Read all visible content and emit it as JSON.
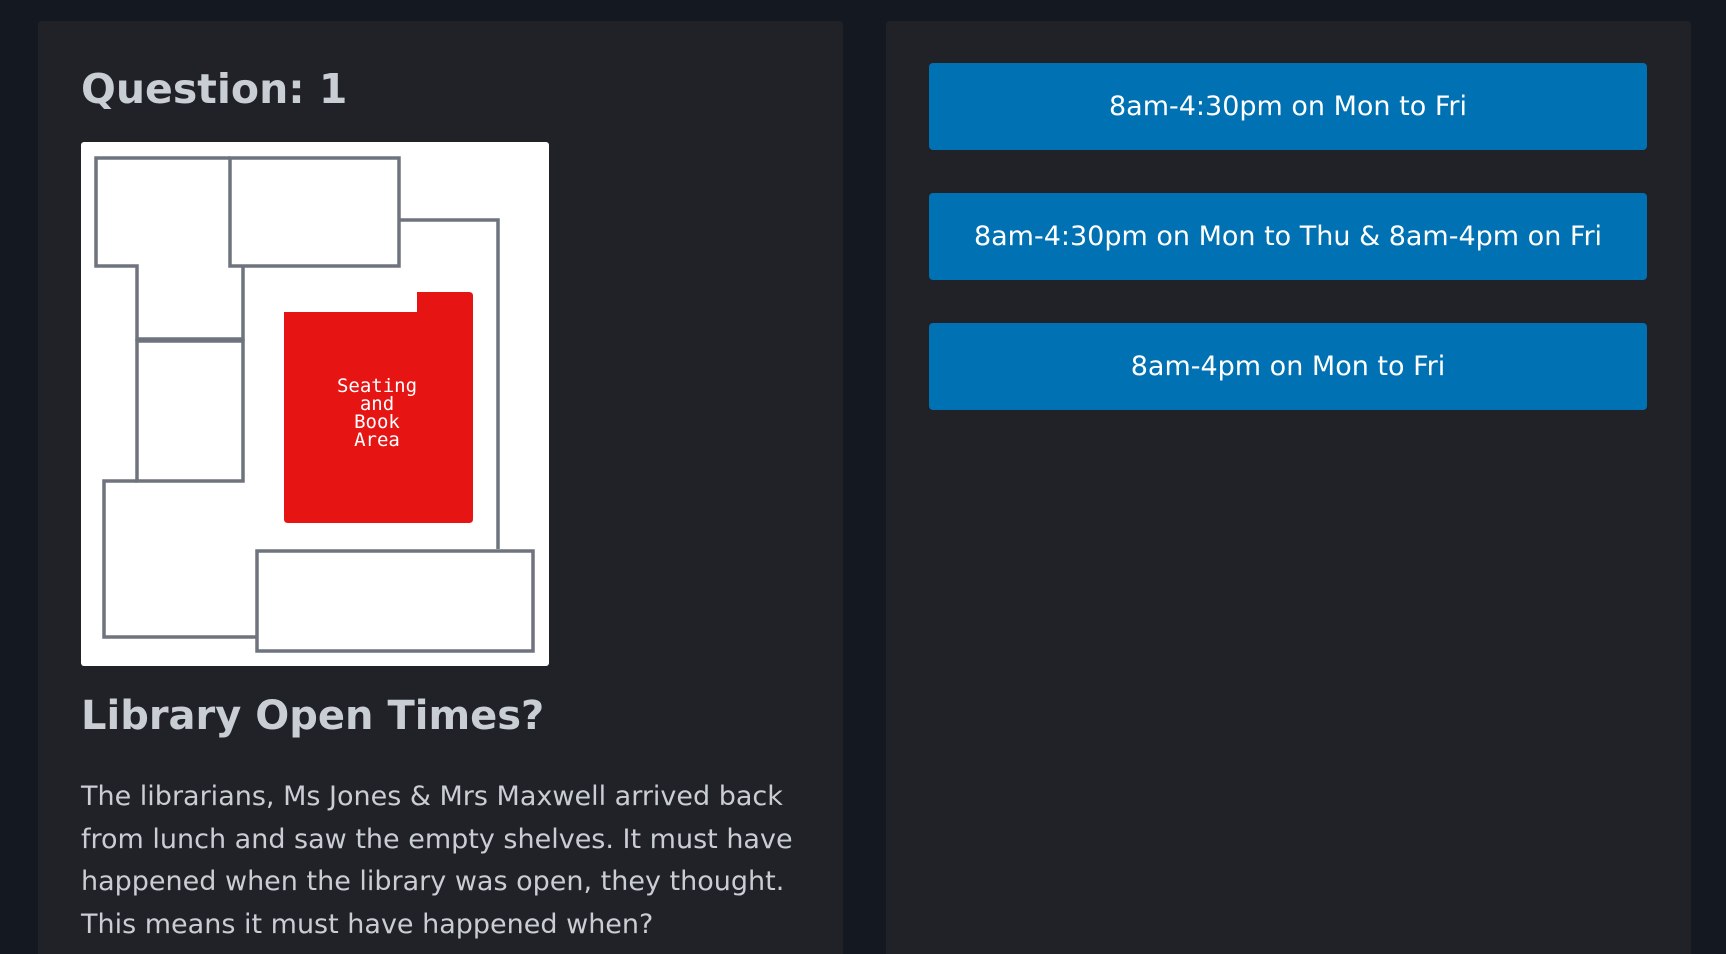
{
  "question": {
    "heading": "Question: 1"
  },
  "map": {
    "highlight_label_lines": [
      "Seating",
      "and",
      "Book",
      "Area"
    ],
    "highlight_color": "#e71414",
    "wall_color": "#6e737d"
  },
  "story": {
    "title": "Library Open Times?",
    "text": "The librarians, Ms Jones & Mrs Maxwell arrived back from lunch and saw the empty shelves. It must have happened when the library was open, they thought. This means it must have happened when?"
  },
  "answers": [
    {
      "label": "8am-4:30pm on Mon to Fri"
    },
    {
      "label": "8am-4:30pm on Mon to Thu & 8am-4pm on Fri"
    },
    {
      "label": "8am-4pm on Mon to Fri"
    }
  ],
  "colors": {
    "page_background": "#141820",
    "panel_background": "#212227",
    "button_background": "#0071b3",
    "text": "#c9cdd4"
  }
}
